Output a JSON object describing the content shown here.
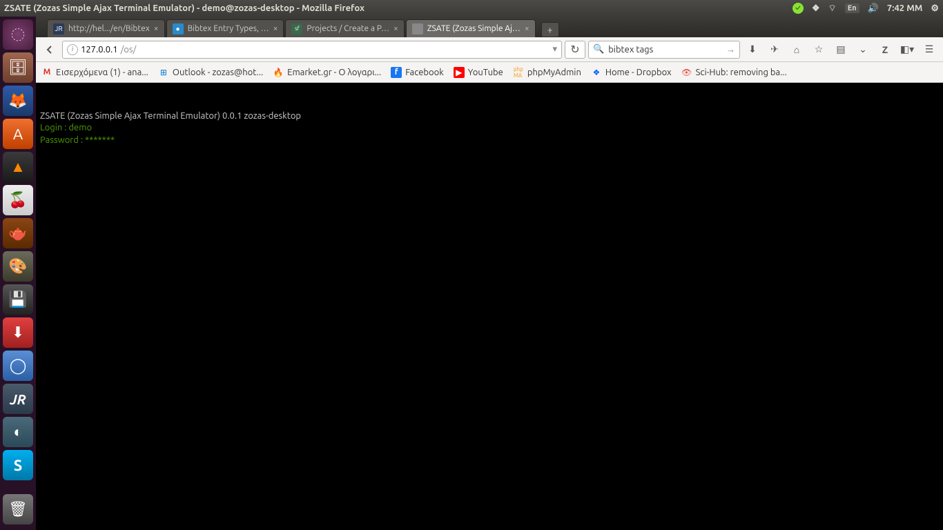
{
  "menubar": {
    "title": "ZSATE (Zozas Simple Ajax Terminal Emulator) - demo@zozas-desktop - Mozilla Firefox",
    "lang": "En",
    "time": "7:42 MM"
  },
  "launcher": {
    "items": [
      {
        "name": "ubuntu-dash",
        "glyph": "◌",
        "cls": "ubuntu"
      },
      {
        "name": "files",
        "glyph": "🗄",
        "cls": "files"
      },
      {
        "name": "firefox",
        "glyph": "🦊",
        "cls": "firefox"
      },
      {
        "name": "software-center",
        "glyph": "A",
        "cls": "software"
      },
      {
        "name": "vlc",
        "glyph": "▲",
        "cls": "vlc"
      },
      {
        "name": "cherrytree",
        "glyph": "🍒",
        "cls": "cherry"
      },
      {
        "name": "teapot",
        "glyph": "🫖",
        "cls": "teapot"
      },
      {
        "name": "gimp",
        "glyph": "🎨",
        "cls": "gimp"
      },
      {
        "name": "disks",
        "glyph": "💾",
        "cls": "disk"
      },
      {
        "name": "downloads",
        "glyph": "⬇",
        "cls": "dl"
      },
      {
        "name": "chromium",
        "glyph": "◯",
        "cls": "chrome"
      },
      {
        "name": "jabref",
        "glyph": "JR",
        "cls": "jabref"
      },
      {
        "name": "scanner",
        "glyph": "◐",
        "cls": "scan"
      },
      {
        "name": "skype",
        "glyph": "S",
        "cls": "skype"
      }
    ],
    "trash_glyph": "🗑"
  },
  "tabs": [
    {
      "label": "http://hel.../en/Bibtex",
      "favicon_bg": "#2a3a5a",
      "favicon_txt": "JR",
      "active": false
    },
    {
      "label": "Bibtex Entry Types, …",
      "favicon_bg": "#2a8aca",
      "favicon_txt": "●",
      "active": false
    },
    {
      "label": "Projects / Create a P…",
      "favicon_bg": "#3a6a4a",
      "favicon_txt": "sf",
      "active": false
    },
    {
      "label": "ZSATE (Zozas Simple Aj…",
      "favicon_bg": "#555",
      "favicon_txt": "",
      "active": true
    }
  ],
  "url": {
    "host": "127.0.0.1",
    "path": "/os/"
  },
  "search": {
    "value": "bibtex tags"
  },
  "bookmarks": [
    {
      "icon": "M",
      "color": "#d93025",
      "label": "Εισερχόμενα (1) - ana..."
    },
    {
      "icon": "⊞",
      "color": "#0078d4",
      "label": "Outlook - zozas@hot..."
    },
    {
      "icon": "🔥",
      "color": "#e67e22",
      "label": "Emarket.gr - Ο λογαρι..."
    },
    {
      "icon": "f",
      "color": "#1877f2",
      "label": "Facebook"
    },
    {
      "icon": "▶",
      "color": "#ff0000",
      "label": "YouTube"
    },
    {
      "icon": "php",
      "color": "#f89406",
      "label": "phpMyAdmin"
    },
    {
      "icon": "📦",
      "color": "#0061ff",
      "label": "Home - Dropbox"
    },
    {
      "icon": "👁",
      "color": "#e74c3c",
      "label": "Sci-Hub: removing ba..."
    }
  ],
  "terminal": {
    "line1": "ZSATE (Zozas Simple Ajax Terminal Emulator) 0.0.1 zozas-desktop",
    "login_label": "Login : ",
    "login_value": "demo",
    "password_label": "Password : ",
    "password_value": "*******"
  }
}
